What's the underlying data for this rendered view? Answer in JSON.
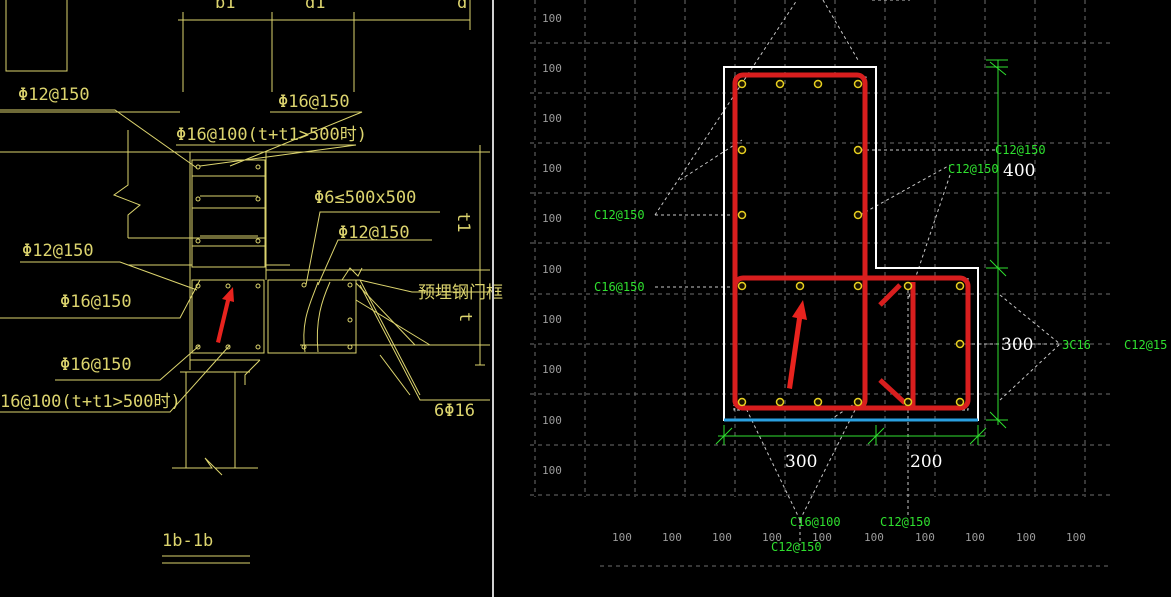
{
  "colors": {
    "background": "#000000",
    "cad_line": "#dcd46e",
    "grid": "#7a7a7a",
    "rebar": "#d81e1e",
    "dimension": "#2fe02f",
    "outline": "#ffffff",
    "base_line": "#2aa0e0",
    "divider": "#d0d0d0"
  },
  "left_panel": {
    "header_labels": [
      "b1",
      "d1",
      "d"
    ],
    "labels": [
      {
        "id": "phi12-150-top",
        "text": "Φ12@150"
      },
      {
        "id": "phi16-150-top",
        "text": "Φ16@150"
      },
      {
        "id": "phi16-100-top",
        "text": "Φ16@100(t+t1>500时)"
      },
      {
        "id": "phi6-stirrup",
        "text": "Φ6≤500x500"
      },
      {
        "id": "phi12-150-mid",
        "text": "Φ12@150"
      },
      {
        "id": "phi12-150-left",
        "text": "Φ12@150"
      },
      {
        "id": "embedded-steel-frame",
        "text": "预埋钢门框"
      },
      {
        "id": "phi16-150-left",
        "text": "Φ16@150"
      },
      {
        "id": "phi16-150-low",
        "text": "Φ16@150"
      },
      {
        "id": "phi16-100-bottom",
        "text": "16@100(t+t1>500时)"
      },
      {
        "id": "six-phi16",
        "text": "6Φ16"
      },
      {
        "id": "dim-t1",
        "text": "t1"
      },
      {
        "id": "dim-t",
        "text": "t"
      }
    ],
    "section_title": "1b-1b"
  },
  "right_panel": {
    "grid_row_labels": [
      "100",
      "100",
      "100",
      "100",
      "100",
      "100",
      "100",
      "100",
      "100",
      "100"
    ],
    "grid_col_labels": [
      "100",
      "100",
      "100",
      "100",
      "100",
      "100",
      "100",
      "100",
      "100",
      "100"
    ],
    "dims": {
      "height_upper": "400",
      "height_lower": "300",
      "width_left": "300",
      "width_right": "200"
    },
    "rebar_labels": [
      {
        "id": "c12-150-right-top",
        "text": "C12@150"
      },
      {
        "id": "c12-150-right-mid",
        "text": "C12@150"
      },
      {
        "id": "c12-150-left",
        "text": "C12@150"
      },
      {
        "id": "c16-150-left",
        "text": "C16@150"
      },
      {
        "id": "three-c16",
        "text": "3C16"
      },
      {
        "id": "c12-150-far-right",
        "text": "C12@15"
      },
      {
        "id": "c16-100-bottom",
        "text": "C16@100"
      },
      {
        "id": "c12-150-bottom-right",
        "text": "C12@150"
      },
      {
        "id": "c12-150-bottom-left",
        "text": "C12@150"
      }
    ]
  }
}
